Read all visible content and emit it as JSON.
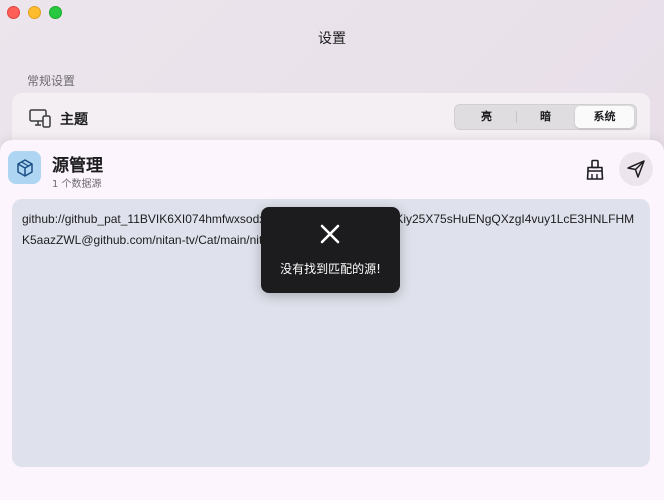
{
  "settings": {
    "title": "设置",
    "section_label": "常规设置",
    "theme": {
      "label": "主题",
      "icon": "monitor-icon",
      "options": [
        "亮",
        "暗",
        "系统"
      ],
      "selected": "系统"
    }
  },
  "source_manager": {
    "title": "源管理",
    "subtitle": "1 个数据源",
    "icon": "cube-icon",
    "actions": {
      "clean_icon": "broom-icon",
      "send_icon": "paper-plane-icon"
    },
    "input_value": "github://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@github.com/nitan-tv/Cat/main/nitan.js.md5"
  },
  "toast": {
    "message": "没有找到匹配的源!",
    "icon": "close-icon"
  },
  "colors": {
    "sheet_background": "#fcf5fd",
    "input_background": "#dfe2ec",
    "toast_background": "#1c1c1e",
    "icon_tile": "#aed5f1"
  }
}
